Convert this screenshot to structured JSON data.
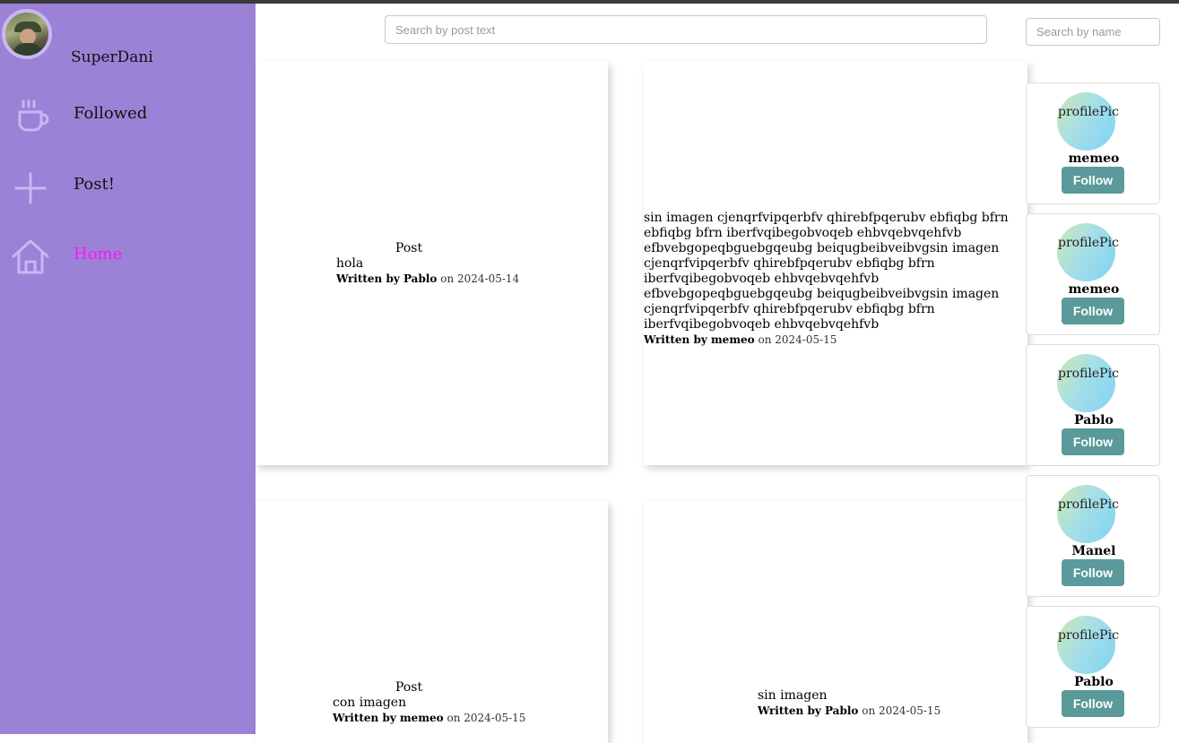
{
  "sidebar": {
    "username": "SuperDani",
    "items": [
      {
        "label": "Followed",
        "icon": "coffee-cup-icon"
      },
      {
        "label": "Post!",
        "icon": "plus-icon"
      },
      {
        "label": "Home",
        "icon": "home-icon",
        "active": true
      }
    ]
  },
  "search": {
    "post_placeholder": "Search by post text",
    "name_placeholder": "Search by name"
  },
  "posts": [
    {
      "image_alt": "Post",
      "text": "hola",
      "written_by": "Written by Pablo",
      "date": "on 2024-05-14"
    },
    {
      "text": "sin imagen cjenqrfvipqerbfv qhirebfpqerubv ebfiqbg bfrn ebfiqbg bfrn iberfvqibegobvoqeb ehbvqebvqehfvb efbvebgopeqbguebgqeubg beiqugbeibveibvgsin imagen cjenqrfvipqerbfv qhirebfpqerubv ebfiqbg bfrn iberfvqibegobvoqeb ehbvqebvqehfvb efbvebgopeqbguebgqeubg beiqugbeibveibvgsin imagen cjenqrfvipqerbfv qhirebfpqerubv ebfiqbg bfrn iberfvqibegobvoqeb ehbvqebvqehfvb",
      "written_by": "Written by memeo",
      "date": "on 2024-05-15"
    },
    {
      "image_alt": "Post",
      "text": "con imagen",
      "written_by": "Written by memeo",
      "date": "on 2024-05-15"
    },
    {
      "text": "sin imagen",
      "written_by": "Written by Pablo",
      "date": "on 2024-05-15"
    }
  ],
  "users": [
    {
      "pic_alt": "profilePic",
      "name": "memeo",
      "button": "Follow"
    },
    {
      "pic_alt": "profilePic",
      "name": "memeo",
      "button": "Follow"
    },
    {
      "pic_alt": "profilePic",
      "name": "Pablo",
      "button": "Follow"
    },
    {
      "pic_alt": "profilePic",
      "name": "Manel",
      "button": "Follow"
    },
    {
      "pic_alt": "profilePic",
      "name": "Pablo",
      "button": "Follow"
    }
  ],
  "colors": {
    "sidebar_bg": "#9b82d6",
    "active_nav": "#ff12ff",
    "follow_button": "#5a9a9a"
  }
}
